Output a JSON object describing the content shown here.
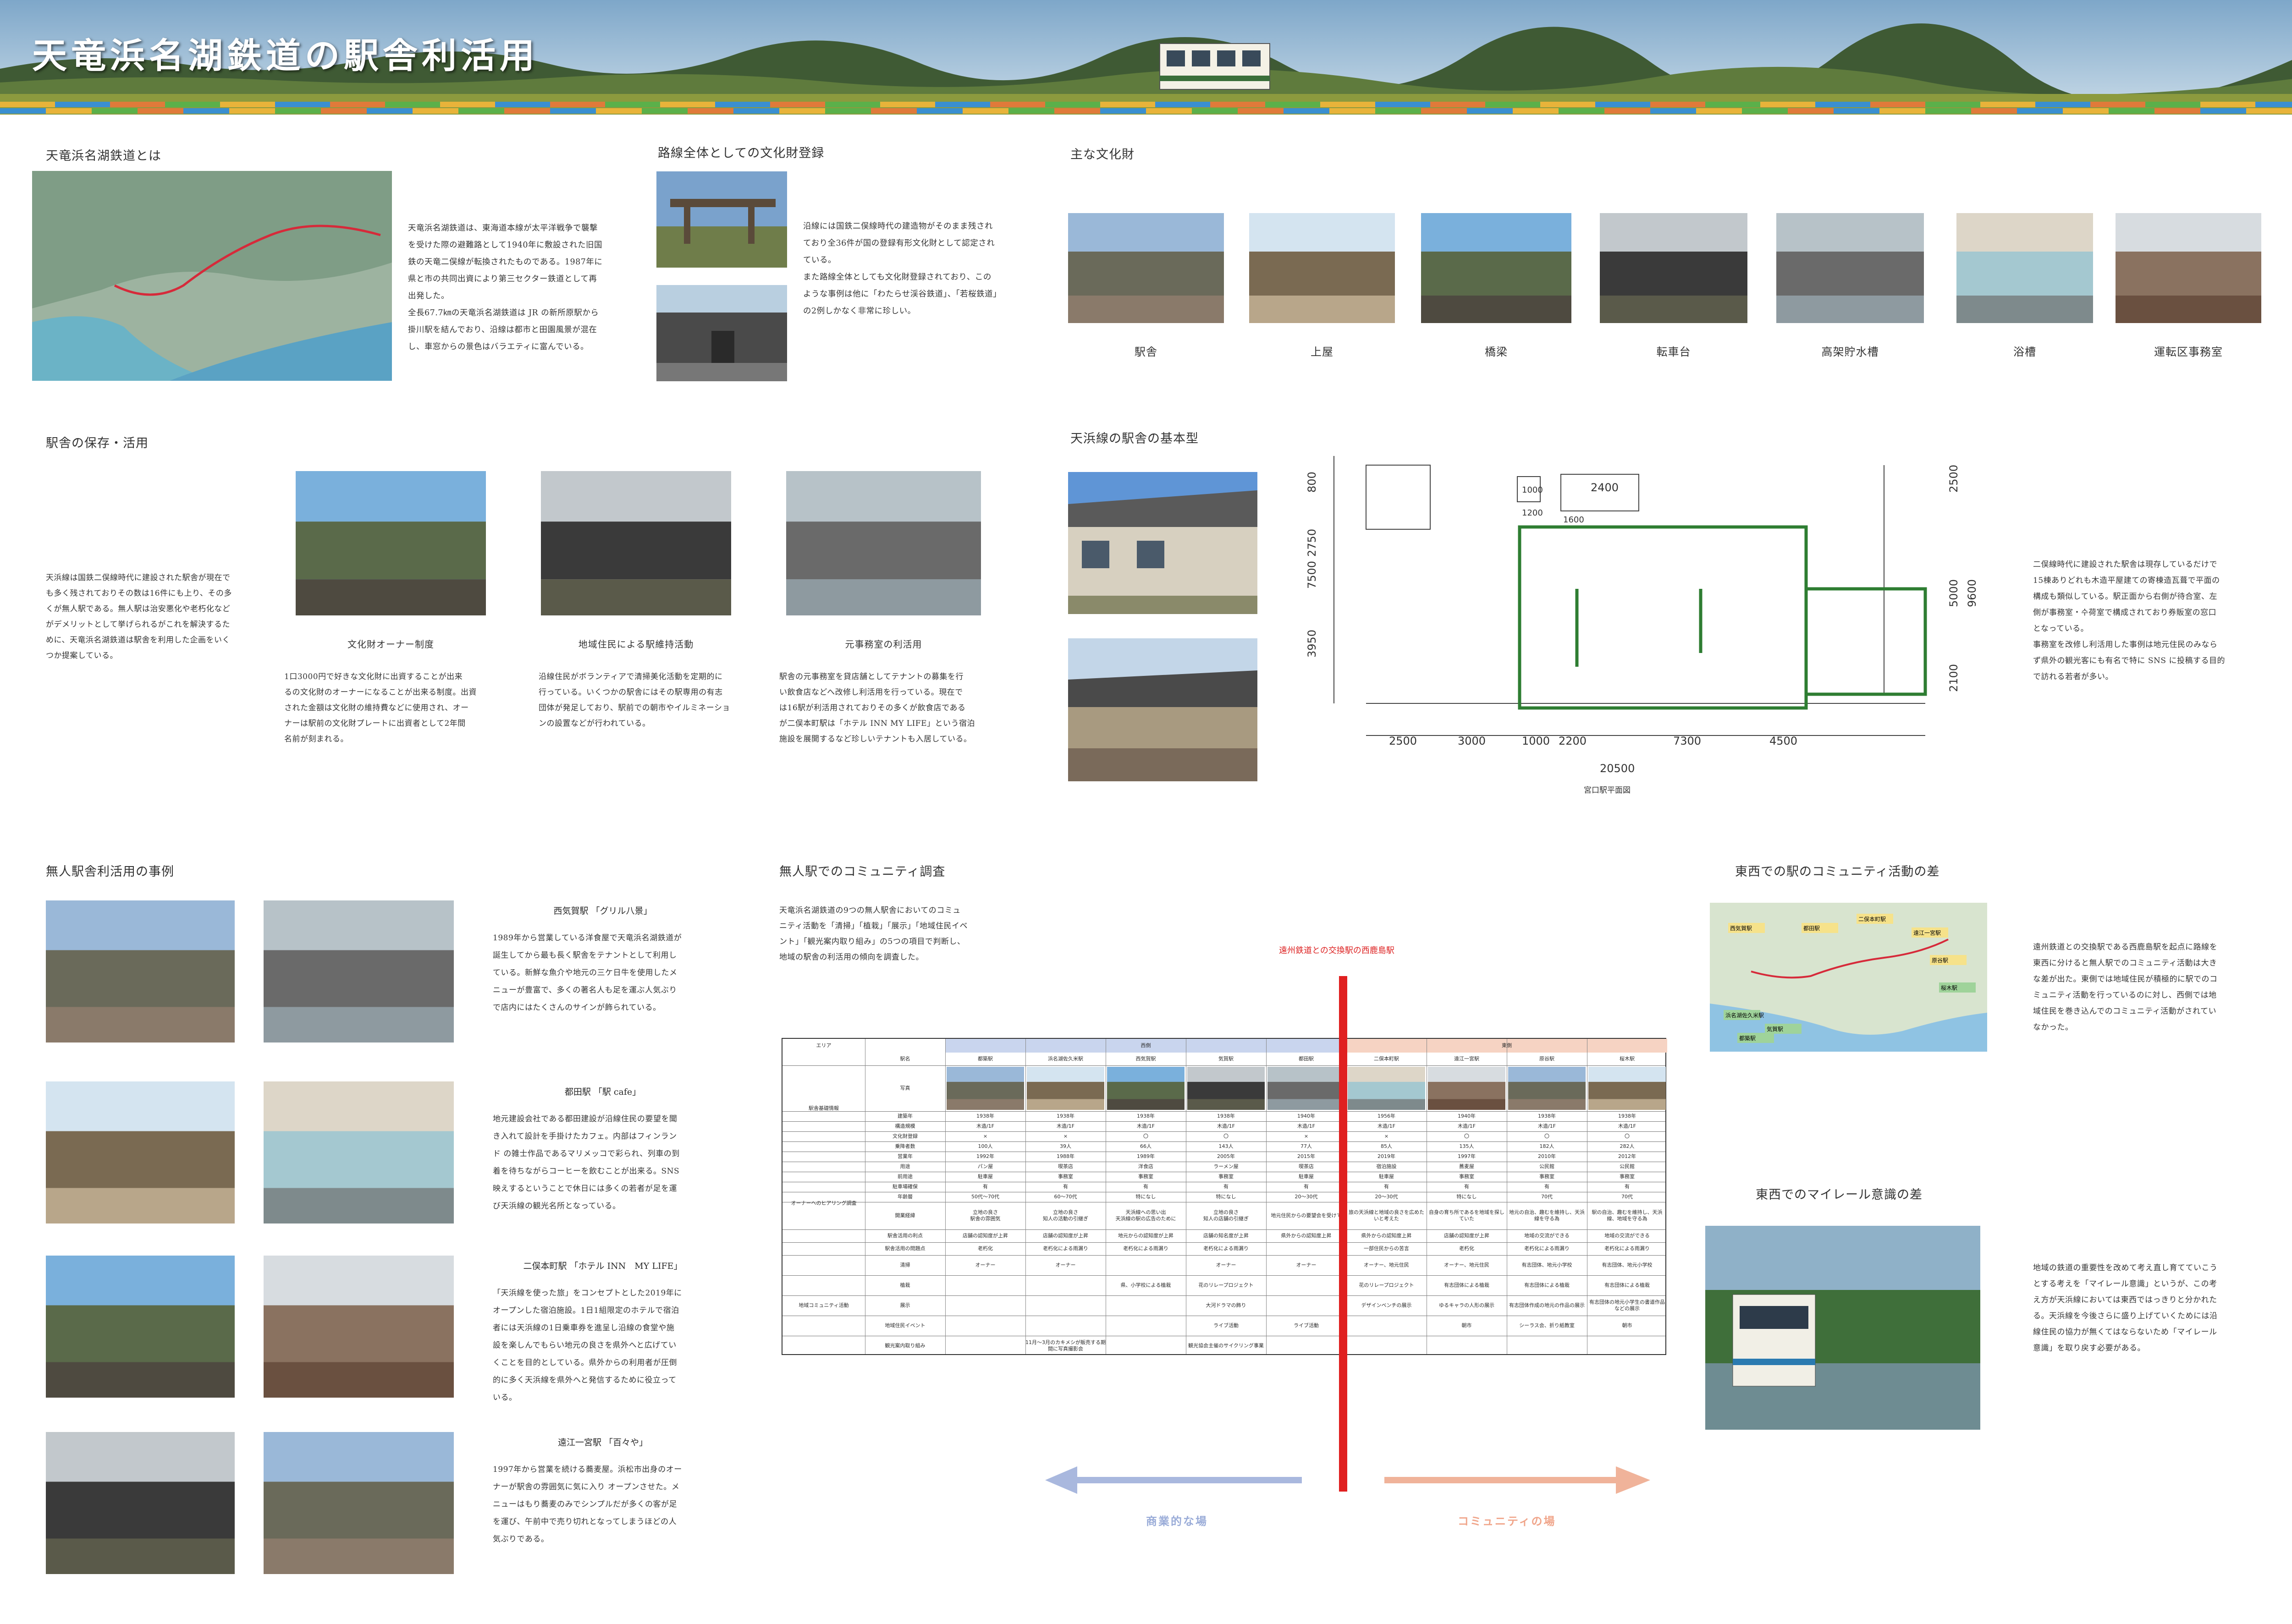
{
  "banner": {
    "title": "天竜浜名湖鉄道の駅舎利活用"
  },
  "about": {
    "heading": "天竜浜名湖鉄道とは",
    "text": "天竜浜名湖鉄道は、東海道本線が太平洋戦争で襲撃\nを受けた際の避難路として1940年に敷設された旧国\n鉄の天竜二俣線が転換されたものである。1987年に\n県と市の共同出資により第三セクター鉄道として再\n出発した。\n全長67.7㎞の天竜浜名湖鉄道は JR の新所原駅から\n掛川駅を結んでおり、沿線は都市と田園風景が混在\nし、車窓からの景色はバラエティに富んでいる。"
  },
  "registration": {
    "heading": "路線全体としての文化財登録",
    "text": "沿線には国鉄二俣線時代の建造物がそのまま残され\nており全36件が国の登録有形文化財として認定され\nている。\nまた路線全体としても文化財登録されており、この\nような事例は他に「わたらせ渓谷鉄道」、「若桜鉄道」\nの2例しかなく非常に珍しい。"
  },
  "heritage": {
    "heading": "主な文化財",
    "items": [
      "駅舎",
      "上屋",
      "橋梁",
      "転車台",
      "高架貯水槽",
      "浴槽",
      "運転区事務室"
    ]
  },
  "preservation": {
    "heading": "駅舎の保存・活用",
    "intro": "天浜線は国鉄二俣線時代に建設された駅舎が現在で\nも多く残されておりその数は16件にも上り、その多\nくが無人駅である。無人駅は治安悪化や老朽化など\nがデメリットとして挙げられるがこれを解決するた\nめに、天竜浜名湖鉄道は駅舎を利用した企画をいく\nつか提案している。",
    "items": [
      {
        "caption": "文化財オーナー制度",
        "text": "1口3000円で好きな文化財に出資することが出来\nるの文化財のオーナーになることが出来る制度。出資\nされた金額は文化財の維持費などに使用され、オー\nナーは駅前の文化財プレートに出資者として2年間\n名前が刻まれる。"
      },
      {
        "caption": "地域住民による駅維持活動",
        "text": "沿線住民がボランティアで清掃美化活動を定期的に\n行っている。いくつかの駅舎にはその駅専用の有志\n団体が発足しており、駅前での朝市やイルミネーショ\nンの設置などが行われている。"
      },
      {
        "caption": "元事務室の利活用",
        "text": "駅舎の元事務室を貸店舗としてテナントの募集を行\nい飲食店などへ改修し利活用を行っている。現在で\nは16駅が利活用されておりその多くが飲食店である\nが二俣本町駅は「ホテル INN MY LIFE」という宿泊\n施設を展開するなど珍しいテナントも入居している。"
      }
    ]
  },
  "basic": {
    "heading": "天浜線の駅舎の基本型",
    "plan_caption": "宮口駅平面図",
    "text": "二俣線時代に建設された駅舎は現存しているだけで\n15棟ありどれも木造平屋建ての寄棟造瓦葺で平面の\n構成も類似している。駅正面から右側が待合室、左\n側が事務室・수荷室で構成されており券販室の窓口\nとなっている。\n事務室を改修し利活用した事例は地元住民のみなら\nず県外の観光客にも有名で特に SNS に投稿する目的\nで訪れる若者が多い。",
    "dims": {
      "top": [
        "2400"
      ],
      "left": [
        "800",
        "2750",
        "7500",
        "3950"
      ],
      "right": [
        "2500",
        "5000",
        "9600",
        "2100"
      ],
      "bottom": [
        "2500",
        "3000",
        "1000",
        "2200",
        "7300",
        "4500"
      ],
      "total": "20500",
      "small": [
        "1000",
        "1200",
        "1600"
      ]
    }
  },
  "cases": {
    "heading": "無人駅舎利活用の事例",
    "items": [
      {
        "title": "西気賀駅 「グリル八景」",
        "text": "1989年から営業している洋食屋で天竜浜名湖鉄道が\n誕生してから最も長く駅舎をテナントとして利用し\nている。新鮮な魚介や地元の三ケ日牛を使用したメ\nニューが豊富で、多くの著名人も足を運ぶ人気ぶり\nで店内にはたくさんのサインが飾られている。"
      },
      {
        "title": "都田駅 「駅 cafe」",
        "text": "地元建設会社である都田建設が沿線住民の要望を聞\nき入れて設計を手掛けたカフェ。内部はフィンラン\nド の雑士作品であるマリメッコで彩られ、列車の到\n着を待ちながらコーヒーを飲むことが出来る。SNS\n映えするということで休日には多くの若者が足を運\nび天浜線の観光名所となっている。"
      },
      {
        "title": "二俣本町駅 「ホテル INN　MY LIFE」",
        "text": "「天浜線を使った旅」をコンセプトとした2019年に\nオープンした宿泊施設。1日1組限定のホテルで宿泊\n者には天浜線の1日乗車券を進呈し沿線の食堂や施\n設を楽しんでもらい地元の良さを県外へと広げてい\nくことを目的としている。県外からの利用者が圧倒\n的に多く天浜線を県外へと発信するために役立って\nいる。"
      },
      {
        "title": "遠江一宮駅 「百々や」",
        "text": "1997年から営業を続ける蕎麦屋。浜松市出身のオー\nナーが駅舎の雰囲気に気に入り オープンさせた。メ\nニューはもり蕎麦のみでシンプルだが多くの客が足\nを運び、午前中で売り切れとなってしまうほどの人\n気ぶりである。"
      }
    ]
  },
  "survey": {
    "heading": "無人駅でのコミュニティ調査",
    "text": "天竜浜名湖鉄道の9つの無人駅舎においてのコミュ\nニティ活動を「清掃」「植栽」「展示」「地域住民イベ\nント」「観光案内取り組み」の5つの項目で判断し、\n地域の駅舎の利活用の傾向を調査した。",
    "divider_label": "遠州鉄道との交換駅の西鹿島駅",
    "arrow_left": "商業的な場",
    "arrow_right": "コミュニティの場",
    "area_label": "エリア",
    "west": "西側",
    "east": "東側",
    "station_label": "駅名",
    "stations": [
      "都築駅",
      "浜名湖佐久米駅",
      "西気賀駅",
      "気賀駅",
      "都田駅",
      "二俣本町駅",
      "遠江一宮駅",
      "原谷駅",
      "桜木駅"
    ],
    "groups": [
      "駅舎基礎情報",
      "オーナーへのヒアリング調査",
      "地域コミュニティ活動"
    ],
    "rows": [
      {
        "label": "写真",
        "cells": [
          "",
          "",
          "",
          "",
          "",
          "",
          "",
          "",
          ""
        ]
      },
      {
        "label": "建築年",
        "cells": [
          "1938年",
          "1938年",
          "1938年",
          "1938年",
          "1940年",
          "1956年",
          "1940年",
          "1938年",
          "1938年"
        ]
      },
      {
        "label": "構造規模",
        "cells": [
          "木造/1F",
          "木造/1F",
          "木造/1F",
          "木造/1F",
          "木造/1F",
          "木造/1F",
          "木造/1F",
          "木造/1F",
          "木造/1F"
        ]
      },
      {
        "label": "文化財登録",
        "cells": [
          "×",
          "×",
          "〇",
          "〇",
          "×",
          "×",
          "〇",
          "〇",
          "〇"
        ]
      },
      {
        "label": "乗降者数",
        "cells": [
          "100人",
          "39人",
          "66人",
          "143人",
          "77人",
          "85人",
          "135人",
          "182人",
          "282人"
        ]
      },
      {
        "label": "営業年",
        "cells": [
          "1992年",
          "1988年",
          "1989年",
          "2005年",
          "2015年",
          "2019年",
          "1997年",
          "2010年",
          "2012年"
        ]
      },
      {
        "label": "用途",
        "cells": [
          "パン屋",
          "喫茶店",
          "洋食店",
          "ラーメン屋",
          "喫茶店",
          "宿泊施設",
          "蕎麦屋",
          "公民館",
          "公民館"
        ]
      },
      {
        "label": "前用途",
        "cells": [
          "駐車屋",
          "事務室",
          "事務室",
          "事務室",
          "駐車屋",
          "駐車屋",
          "事務室",
          "事務室",
          "事務室"
        ]
      },
      {
        "label": "駐車場確保",
        "cells": [
          "有",
          "有",
          "有",
          "有",
          "有",
          "有",
          "有",
          "有",
          "有"
        ]
      },
      {
        "label": "年齢層",
        "cells": [
          "50代〜70代",
          "60〜70代",
          "特になし",
          "特になし",
          "20〜30代",
          "20〜30代",
          "特になし",
          "70代",
          "70代"
        ]
      },
      {
        "label": "開業経緯",
        "cells": [
          "立地の良さ\n駅舎の雰囲気",
          "立地の良さ\n知人の活動の引継ぎ",
          "天浜線への思い出\n天浜線の駅の広告のために",
          "立地の良さ\n知人の店舗の引継ぎ",
          "地元住民からの要望会を受けて",
          "旅の天浜線と地域の良さを広めたいと考えた",
          "自身の育ち所であるを地域を探していた",
          "地元の自治、趣むを維持し、天浜線を守る為",
          "駅の自治、趣むを維持し、天浜線、地域を守る為"
        ]
      },
      {
        "label": "駅舎活用の利点",
        "cells": [
          "店舗の認知度が上昇",
          "店舗の認知度が上昇",
          "地元からの認知度が上昇",
          "店舗の知名度が上昇",
          "県外からの認知度上昇",
          "県外からの認知度上昇",
          "店舗の認知度が上昇",
          "地域の交流ができる",
          "地域の交流ができる"
        ]
      },
      {
        "label": "駅舎活用の問題点",
        "cells": [
          "老朽化",
          "老朽化による雨漏り",
          "老朽化による雨漏り",
          "老朽化による雨漏り",
          "",
          "一部住民からの苦言",
          "老朽化",
          "老朽化による雨漏り",
          "老朽化による雨漏り"
        ]
      },
      {
        "label": "清掃",
        "cells": [
          "オーナー",
          "オーナー",
          "",
          "オーナー",
          "オーナー",
          "オーナー、地元住民",
          "オーナー、地元住民",
          "有志団体、地元小学校",
          "有志団体、地元小学校"
        ]
      },
      {
        "label": "植栽",
        "cells": [
          "",
          "",
          "県、小学校による植栽",
          "花のリレープロジェクト",
          "",
          "花のリレープロジェクト",
          "有志団体による植栽",
          "有志団体による植栽",
          "有志団体による植栽"
        ]
      },
      {
        "label": "展示",
        "cells": [
          "",
          "",
          "",
          "大河ドラマの飾り",
          "",
          "デザインベンチの展示",
          "ゆるキャラの人形の展示",
          "有志団体作成の地元の作品の展示",
          "有志団体の地元小学生の書道作品などの展示"
        ]
      },
      {
        "label": "地域住民イベント",
        "cells": [
          "",
          "",
          "",
          "ライブ活動",
          "ライブ活動",
          "",
          "朝市",
          "シーラス会、折り紙教室",
          "朝市"
        ]
      },
      {
        "label": "観光案内取り組み",
        "cells": [
          "",
          "11月〜3月のカキメシが販売する期間に写真撮影会",
          "",
          "観光協会主催のサイクリング事業",
          "",
          "",
          "",
          "",
          ""
        ]
      }
    ]
  },
  "eastwest": {
    "heading": "東西での駅のコミュニティ活動の差",
    "text": "遠州鉄道との交換駅である西鹿島駅を起点に路線を\n東西に分けると無人駅でのコミュニティ活動は大き\nな差が出た。東側では地域住民が積極的に駅でのコ\nミュニティ活動を行っているのに対し、西側では地\n域住民を巻き込んでのコミュニティ活動がされてい\nなかった。",
    "map_labels": [
      "西気賀駅",
      "都田駅",
      "二俣本町駅",
      "遠江一宮駅",
      "原谷駅",
      "桜木駅",
      "浜名湖佐久米駅",
      "気賀駅",
      "都築駅"
    ]
  },
  "myrail": {
    "heading": "東西でのマイレール意識の差",
    "text": "地域の鉄道の重要性を改めて考え直し育てていこう\nとする考えを「マイレール意識」というが、この考\nえ方が天浜線においては東西ではっきりと分かれた\nる。天浜線を今後さらに盛り上げていくためには沿\n線住民の協力が無くてはならないため「マイレール\n意識」を取り戻す必要がある。"
  },
  "colors": {
    "plan_green": "#2e7d32",
    "divider_red": "#e02020",
    "west_blue": "#a9b8de",
    "east_salmon": "#f0b39a",
    "table_west_header": "#c9d5ee",
    "table_east_header": "#f6d3c3"
  }
}
